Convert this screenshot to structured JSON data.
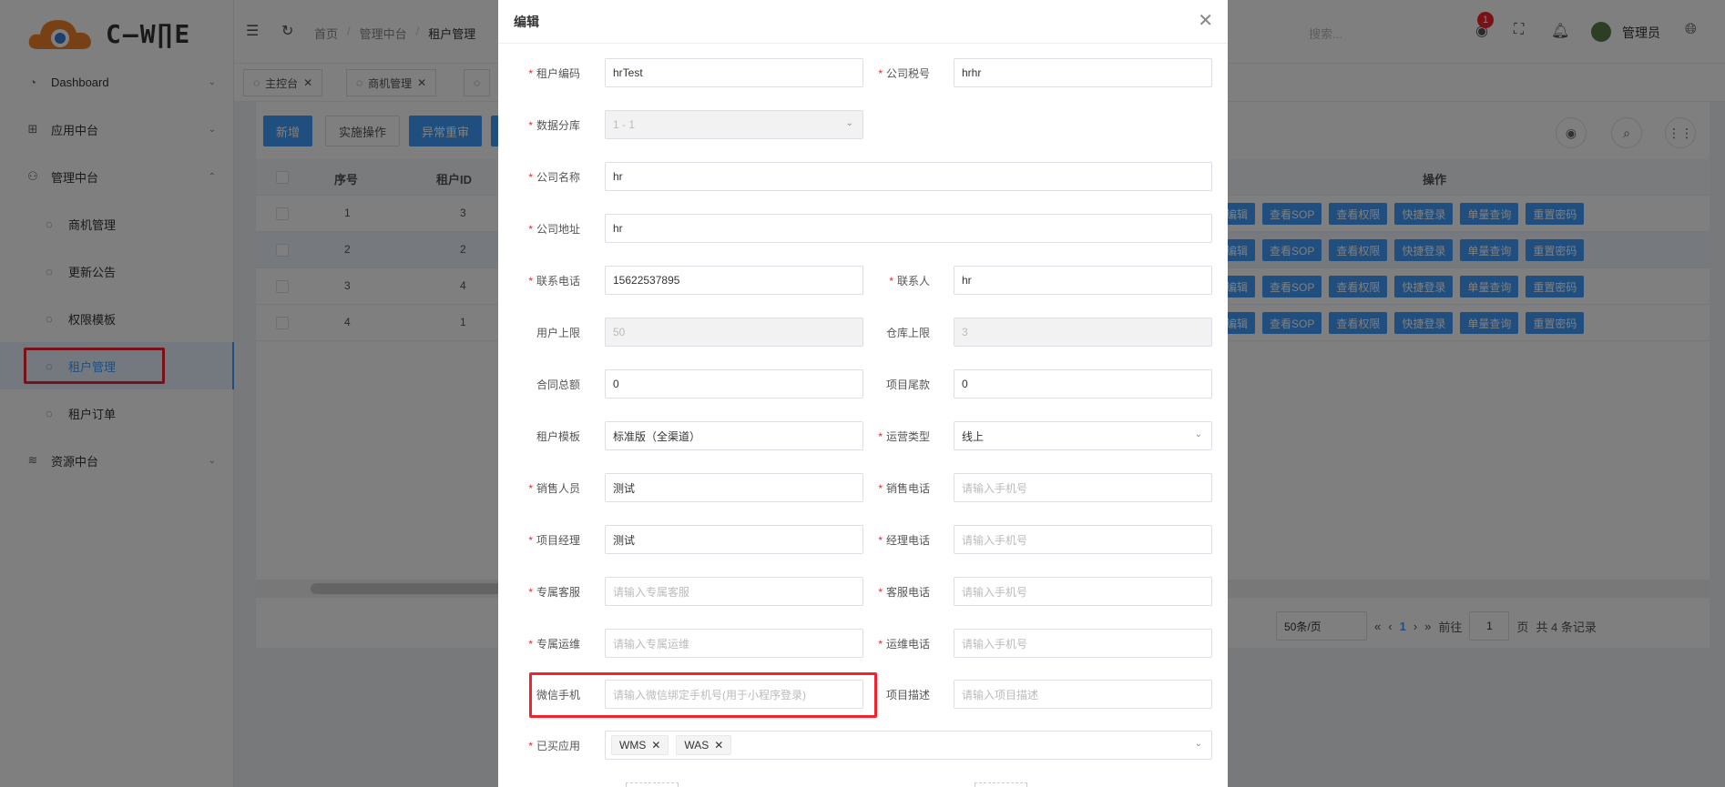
{
  "app": {
    "logo_text": "C—W∏E"
  },
  "sidebar": {
    "items": [
      {
        "label": "Dashboard"
      },
      {
        "label": "应用中台"
      },
      {
        "label": "管理中台"
      },
      {
        "label": "商机管理"
      },
      {
        "label": "更新公告"
      },
      {
        "label": "权限模板"
      },
      {
        "label": "租户管理"
      },
      {
        "label": "租户订单"
      },
      {
        "label": "资源中台"
      }
    ]
  },
  "header": {
    "breadcrumb": [
      "首页",
      "管理中台",
      "租户管理"
    ],
    "search_placeholder": "搜索...",
    "notification_count": "1",
    "username": "管理员"
  },
  "tabs": [
    {
      "label": "主控台"
    },
    {
      "label": "商机管理"
    }
  ],
  "toolbar": {
    "add": "新增",
    "impl": "实施操作",
    "reset": "异常重审"
  },
  "table": {
    "headers": {
      "index": "序号",
      "tenant_id": "租户ID",
      "ops": "操作"
    },
    "rows": [
      {
        "index": "1",
        "tenant_id": "3"
      },
      {
        "index": "2",
        "tenant_id": "2"
      },
      {
        "index": "3",
        "tenant_id": "4"
      },
      {
        "index": "4",
        "tenant_id": "1"
      }
    ],
    "op_labels": [
      "编辑",
      "查看SOP",
      "查看权限",
      "快捷登录",
      "单量查询",
      "重置密码"
    ]
  },
  "pagination": {
    "page_size": "50条/页",
    "current": "1",
    "goto_label": "前往",
    "goto_value": "1",
    "page_suffix": "页",
    "total": "共 4 条记录"
  },
  "dialog": {
    "title": "编辑",
    "fields": {
      "tenant_code": {
        "label": "租户编码",
        "value": "hrTest"
      },
      "tax_no": {
        "label": "公司税号",
        "value": "hrhr"
      },
      "db_shard": {
        "label": "数据分库",
        "value": "1 - 1"
      },
      "company_name": {
        "label": "公司名称",
        "value": "hr"
      },
      "company_addr": {
        "label": "公司地址",
        "value": "hr"
      },
      "phone": {
        "label": "联系电话",
        "value": "15622537895"
      },
      "contact": {
        "label": "联系人",
        "value": "hr"
      },
      "user_limit": {
        "label": "用户上限",
        "value": "50"
      },
      "warehouse_limit": {
        "label": "仓库上限",
        "value": "3"
      },
      "contract_total": {
        "label": "合同总额",
        "value": "0"
      },
      "project_balance": {
        "label": "项目尾款",
        "value": "0"
      },
      "tenant_template": {
        "label": "租户模板",
        "value": "标准版（全渠道）"
      },
      "ops_type": {
        "label": "运营类型",
        "value": "线上"
      },
      "sales_person": {
        "label": "销售人员",
        "value": "测试"
      },
      "sales_phone": {
        "label": "销售电话",
        "placeholder": "请输入手机号"
      },
      "project_manager": {
        "label": "项目经理",
        "value": "测试"
      },
      "manager_phone": {
        "label": "经理电话",
        "placeholder": "请输入手机号"
      },
      "cs": {
        "label": "专属客服",
        "placeholder": "请输入专属客服"
      },
      "cs_phone": {
        "label": "客服电话",
        "placeholder": "请输入手机号"
      },
      "ops_person": {
        "label": "专属运维",
        "placeholder": "请输入专属运维"
      },
      "ops_phone": {
        "label": "运维电话",
        "placeholder": "请输入手机号"
      },
      "wechat_phone": {
        "label": "微信手机",
        "placeholder": "请输入微信绑定手机号(用于小程序登录)"
      },
      "project_desc": {
        "label": "项目描述",
        "placeholder": "请输入项目描述"
      },
      "bought_apps": {
        "label": "已买应用",
        "tags": [
          "WMS",
          "WAS"
        ]
      }
    }
  }
}
